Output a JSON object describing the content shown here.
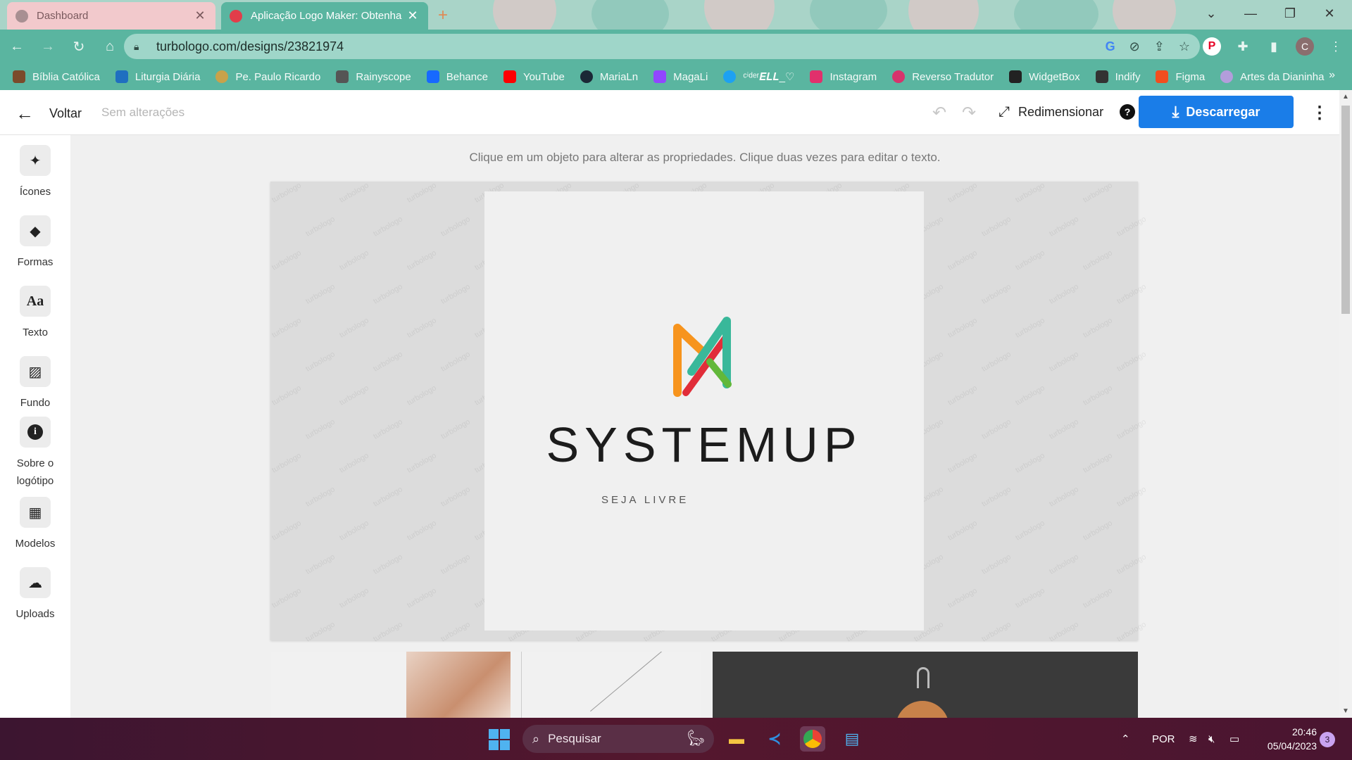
{
  "browser": {
    "tabs": [
      {
        "label": "Dashboard",
        "active": false
      },
      {
        "label": "Aplicação Logo Maker: Obtenha",
        "active": true
      }
    ],
    "new_tab": "+",
    "url": "turbologo.com/designs/23821974",
    "profile_initial": "C",
    "bookmarks": [
      {
        "label": "Bíblia Católica",
        "icon": "bible-icon",
        "color": "#7b4a2a"
      },
      {
        "label": "Liturgia Diária",
        "icon": "liturgia-icon",
        "color": "#1f6fc0"
      },
      {
        "label": "Pe. Paulo Ricardo",
        "icon": "paulo-ricardo-icon",
        "color": "#c9a24a"
      },
      {
        "label": "Rainyscope",
        "icon": "rainyscope-icon",
        "color": "#555555"
      },
      {
        "label": "Behance",
        "icon": "behance-icon",
        "color": "#1769ff"
      },
      {
        "label": "YouTube",
        "icon": "youtube-icon",
        "color": "#ff0000"
      },
      {
        "label": "MariaLn",
        "icon": "tumblr-icon",
        "color": "#1b2836"
      },
      {
        "label": "MagaLi",
        "icon": "twitch-icon",
        "color": "#9146ff"
      },
      {
        "label": "ᶜⁱᵈᵉʳ𝑬𝑳𝑳_♡",
        "icon": "twitter-icon",
        "color": "#1da1f2"
      },
      {
        "label": "Instagram",
        "icon": "instagram-icon",
        "color": "#e1306c"
      },
      {
        "label": "Reverso Tradutor",
        "icon": "reverso-icon",
        "color": "#d6336c"
      },
      {
        "label": "WidgetBox",
        "icon": "widgetbox-icon",
        "color": "#222222"
      },
      {
        "label": "Indify",
        "icon": "indify-icon",
        "color": "#333333"
      },
      {
        "label": "Figma",
        "icon": "figma-icon",
        "color": "#f24e1e"
      },
      {
        "label": "Artes da Dianinha",
        "icon": "dianinha-icon",
        "color": "#b39ddb"
      }
    ],
    "bookmarks_more": "»"
  },
  "app": {
    "back_label": "Voltar",
    "save_status": "Sem alterações",
    "resize_label": "Redimensionar",
    "download_label": "Descarregar",
    "accent": "#1a7de8"
  },
  "sidebar": [
    {
      "label": "Ícones",
      "icon": "sparkle-icon",
      "glyph": "✦"
    },
    {
      "label": "Formas",
      "icon": "shapes-icon",
      "glyph": "◆"
    },
    {
      "label": "Texto",
      "icon": "text-icon",
      "glyph": "Aa"
    },
    {
      "label": "Fundo",
      "icon": "background-icon",
      "glyph": "▨"
    },
    {
      "label": "Sobre o logótipo",
      "icon": "info-icon",
      "glyph": "i"
    },
    {
      "label": "Modelos",
      "icon": "templates-icon",
      "glyph": "▦"
    },
    {
      "label": "Uploads",
      "icon": "upload-cloud-icon",
      "glyph": "☁"
    }
  ],
  "workspace": {
    "hint": "Clique em um objeto para alterar as propriedades. Clique duas vezes para editar o texto.",
    "logo_brand": "SYSTEMUP",
    "logo_slogan": "SEJA LIVRE",
    "watermark": "turbologo",
    "logo_colors": [
      "#f7941d",
      "#e12d39",
      "#39b89a",
      "#62b83a"
    ]
  },
  "taskbar": {
    "search_placeholder": "Pesquisar",
    "language": "POR",
    "time": "20:46",
    "date": "05/04/2023",
    "notifications": "3"
  }
}
